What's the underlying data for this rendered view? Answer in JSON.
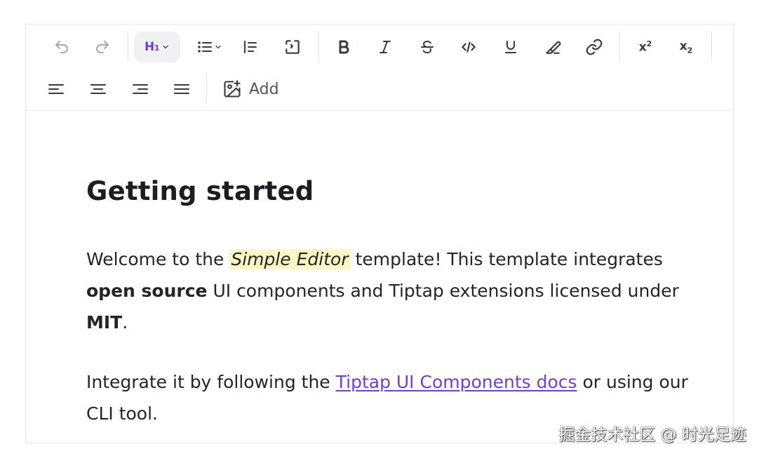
{
  "toolbar": {
    "heading_label": "H",
    "heading_level": "1",
    "superscript_base": "x",
    "superscript_mark": "2",
    "subscript_base": "x",
    "subscript_mark": "2",
    "add_label": "Add",
    "active_color": "#6b3fe0",
    "icons": [
      "undo-icon",
      "redo-icon",
      "heading-dropdown",
      "list-icon",
      "blockquote-icon",
      "code-block-icon",
      "bold-icon",
      "italic-icon",
      "strike-icon",
      "code-icon",
      "underline-icon",
      "highlighter-icon",
      "link-icon",
      "superscript-icon",
      "subscript-icon",
      "align-left-icon",
      "align-center-icon",
      "align-right-icon",
      "align-justify-icon",
      "image-add-icon"
    ]
  },
  "document": {
    "title": "Getting started",
    "para1": {
      "t1": "Welcome to the ",
      "highlight": "Simple Editor",
      "t2": " template! This template integrates ",
      "bold1": "open source",
      "t3": " UI components and Tiptap extensions licensed under ",
      "bold2": "MIT",
      "t4": "."
    },
    "para2": {
      "t1": "Integrate it by following the ",
      "link": "Tiptap UI Components docs",
      "t2": " or using our CLI tool."
    },
    "highlight_color": "#fcf6c2",
    "link_color": "#6b3fe0"
  },
  "watermark": "掘金技术社区 @ 时光足迹"
}
